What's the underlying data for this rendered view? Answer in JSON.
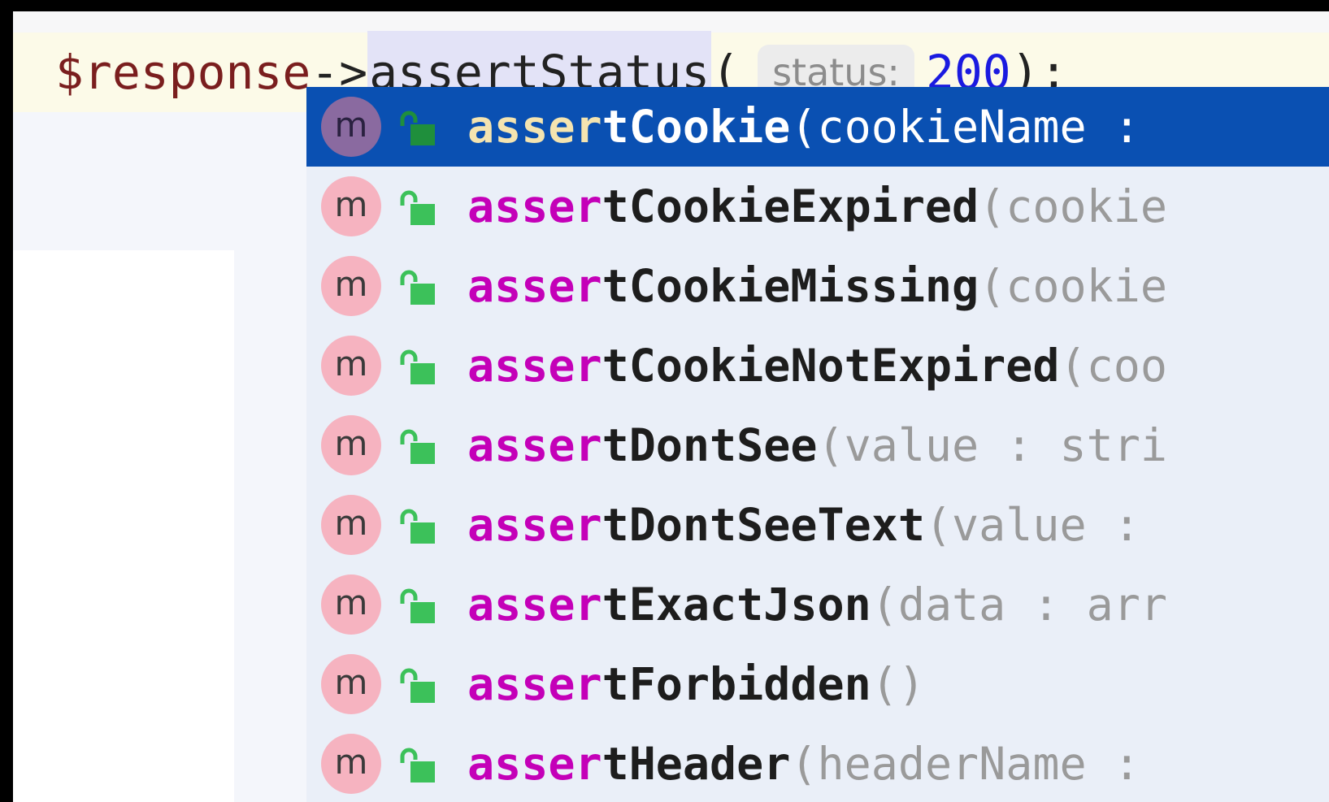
{
  "editor": {
    "code_line": {
      "variable": "$response",
      "arrow": "->",
      "method": "assertStatus",
      "open_paren": "(",
      "param_hint": "status:",
      "argument": "200",
      "close": ");"
    }
  },
  "completion_popup": {
    "typed_prefix": "asser",
    "kind_letter": "m",
    "items": [
      {
        "prefix": "asser",
        "rest": "tCookie",
        "signature": "(cookieName :",
        "selected": true
      },
      {
        "prefix": "asser",
        "rest": "tCookieExpired",
        "signature": "(cookie",
        "selected": false
      },
      {
        "prefix": "asser",
        "rest": "tCookieMissing",
        "signature": "(cookie",
        "selected": false
      },
      {
        "prefix": "asser",
        "rest": "tCookieNotExpired",
        "signature": "(coo",
        "selected": false
      },
      {
        "prefix": "asser",
        "rest": "tDontSee",
        "signature": "(value : stri",
        "selected": false
      },
      {
        "prefix": "asser",
        "rest": "tDontSeeText",
        "signature": "(value :",
        "selected": false
      },
      {
        "prefix": "asser",
        "rest": "tExactJson",
        "signature": "(data : arr",
        "selected": false
      },
      {
        "prefix": "asser",
        "rest": "tForbidden",
        "signature": "()",
        "selected": false
      },
      {
        "prefix": "asser",
        "rest": "tHeader",
        "signature": "(headerName :",
        "selected": false
      }
    ]
  },
  "icons": {
    "method_kind": "method-icon",
    "visibility": "public-unlocked-icon"
  },
  "colors": {
    "selection": "#0a50b2",
    "match_highlight": "#c400b8",
    "selected_match_highlight": "#f4e4b0",
    "method_icon_bg": "#f6b3c0",
    "selected_method_icon_bg": "#8a6aa0",
    "lock_icon": "#3cc15a",
    "selected_lock_icon": "#1f8f3c",
    "variable": "#7a1e1e",
    "number": "#1a1ae0",
    "current_line": "#fcfae8"
  }
}
